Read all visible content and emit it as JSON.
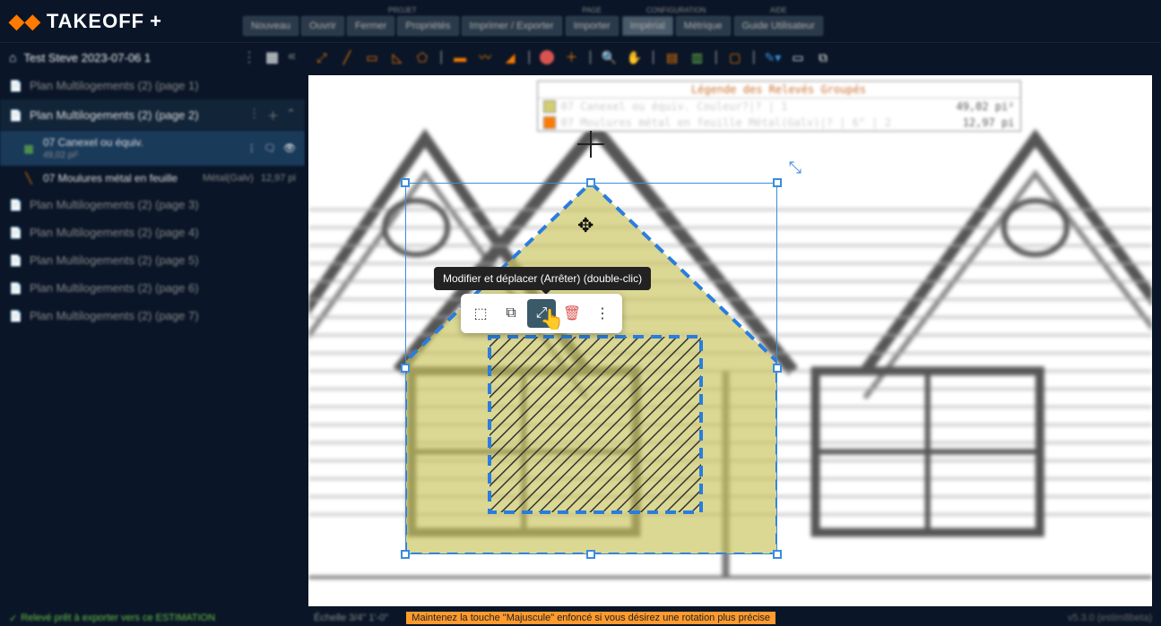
{
  "app": {
    "name": "TAKEOFF",
    "plus": "+"
  },
  "menu": {
    "projet": {
      "label": "PROJET",
      "items": [
        "Nouveau",
        "Ouvrir",
        "Fermer",
        "Propriétés",
        "Imprimer / Exporter"
      ]
    },
    "page": {
      "label": "PAGE",
      "items": [
        "Importer"
      ]
    },
    "config": {
      "label": "CONFIGURATION",
      "items": [
        "Impérial",
        "Métrique"
      ]
    },
    "aide": {
      "label": "AIDE",
      "items": [
        "Guide Utilisateur"
      ]
    }
  },
  "project": {
    "name": "Test Steve 2023-07-06 1"
  },
  "sidebar": {
    "pages": [
      {
        "label": "Plan Multilogements (2) (page 1)"
      },
      {
        "label": "Plan Multilogements (2) (page 2)",
        "active": true
      },
      {
        "label": "Plan Multilogements (2) (page 3)"
      },
      {
        "label": "Plan Multilogements (2) (page 4)"
      },
      {
        "label": "Plan Multilogements (2) (page 5)"
      },
      {
        "label": "Plan Multilogements (2) (page 6)"
      },
      {
        "label": "Plan Multilogements (2) (page 7)"
      }
    ],
    "items": [
      {
        "title": "07 Canexel ou équiv.",
        "sub": "49,02 pi²",
        "selected": true,
        "color": "#6bbd45"
      },
      {
        "title": "07 Moulures métal en feuille",
        "meta": "Métal(Galv)",
        "right": "12,97 pi",
        "color": "#ff7a00"
      }
    ]
  },
  "legend": {
    "title": "Légende des Relevés Groupés",
    "rows": [
      {
        "swatch": "y",
        "text": "07 Canexel ou équiv. Couleur?|? | 1",
        "val": "49,02 pi²"
      },
      {
        "swatch": "o",
        "text": "07 Moulures métal en feuille Métal(Galv)|? | 6\" | 2",
        "val": "12,97 pi"
      }
    ]
  },
  "tooltip": "Modifier et déplacer (Arrêter) (double-clic)",
  "footer": {
    "status": "Relevé prêt à exporter vers ce ESTIMATION",
    "scale": "Échelle 3/4\" 1'-0\"",
    "hint": "Maintenez la touche \"Majuscule\" enfoncé si vous désirez une rotation plus précise",
    "version": "v5.3.0 (estim8beta)"
  }
}
